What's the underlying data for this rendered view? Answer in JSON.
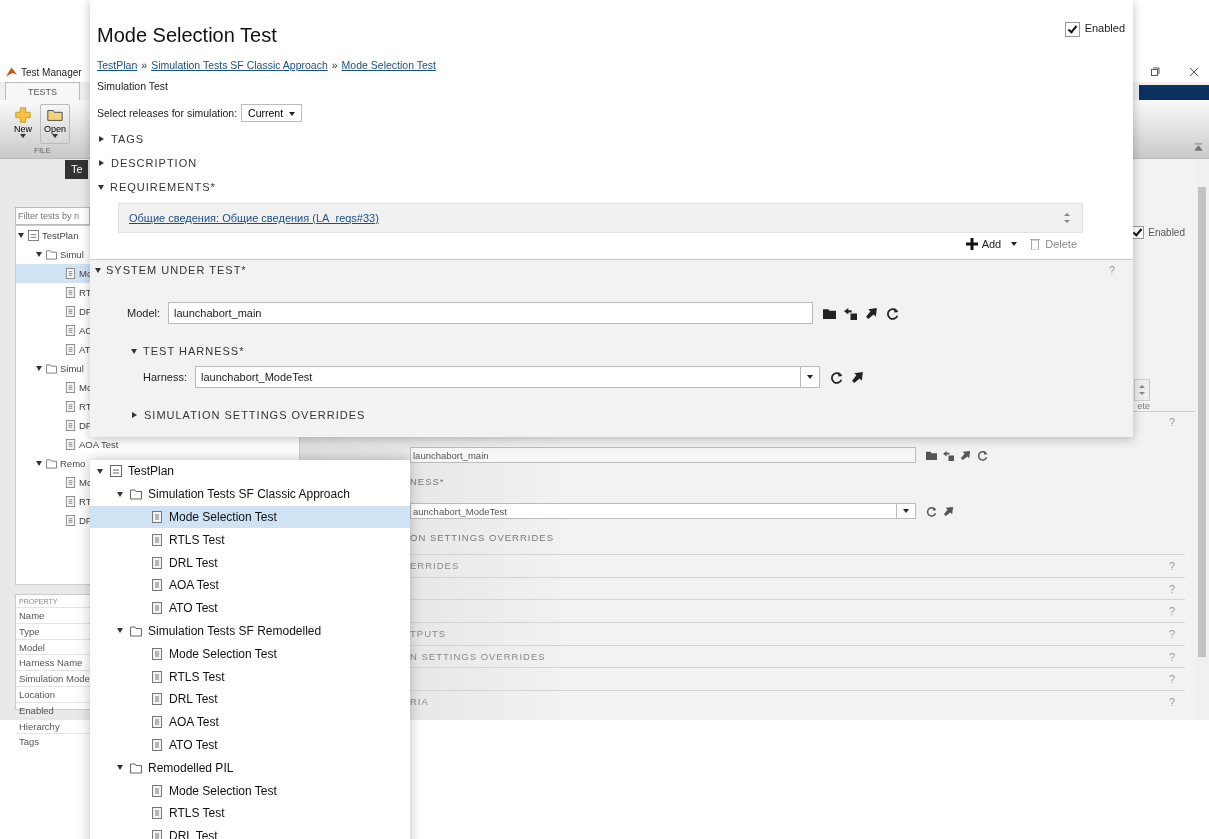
{
  "background_window": {
    "title": "Test Manager",
    "toolstrip_tab": "TESTS",
    "toolstrip_buttons": [
      {
        "label": "New",
        "kind": "new"
      },
      {
        "label": "Open",
        "kind": "open"
      }
    ],
    "toolstrip_group": "FILE",
    "browser_tab": "Te",
    "filter": {
      "placeholder": "Filter tests by n"
    },
    "tree": [
      {
        "label": "TestPlan",
        "kind": "plan",
        "expanded": true,
        "selected": false,
        "children": [
          {
            "label": "Simul",
            "kind": "folder",
            "expanded": true,
            "selected": false,
            "children": [
              {
                "label": "Mc",
                "kind": "test",
                "selected": true
              },
              {
                "label": "RT",
                "kind": "test",
                "selected": false
              },
              {
                "label": "DF",
                "kind": "test",
                "selected": false
              },
              {
                "label": "AC",
                "kind": "test",
                "selected": false
              },
              {
                "label": "AT",
                "kind": "test",
                "selected": false
              }
            ]
          },
          {
            "label": "Simul",
            "kind": "folder",
            "expanded": true,
            "selected": false,
            "children": [
              {
                "label": "Mc",
                "kind": "test",
                "selected": false
              },
              {
                "label": "RT",
                "kind": "test",
                "selected": false
              },
              {
                "label": "DF",
                "kind": "test",
                "selected": false
              },
              {
                "label": "AOA Test",
                "kind": "test",
                "selected": false
              }
            ]
          },
          {
            "label": "Remo",
            "kind": "folder",
            "expanded": true,
            "selected": false,
            "children": [
              {
                "label": "Mc",
                "kind": "test",
                "selected": false
              },
              {
                "label": "RT",
                "kind": "test",
                "selected": false
              },
              {
                "label": "DF",
                "kind": "test",
                "selected": false
              }
            ]
          }
        ]
      }
    ],
    "properties": {
      "header": "PROPERTY",
      "rows": [
        "Name",
        "Type",
        "Model",
        "Harness Name",
        "Simulation Mode",
        "Location",
        "Enabled",
        "Hierarchy",
        "Tags"
      ]
    },
    "enabled": {
      "label": "Enabled",
      "checked": true
    },
    "delete_fragment": "ete",
    "help": "?",
    "model_field": "launchabort_main",
    "harness_fragment": "NESS*",
    "harness_field": "aunchabort_ModeTest",
    "overrides_fragment": "ON SETTINGS OVERRIDES",
    "sections": [
      {
        "label": "ERRIDES",
        "help": "?"
      },
      {
        "help": "?"
      },
      {
        "help": "?"
      },
      {
        "label": "TPUTS",
        "help": "?"
      },
      {
        "label": "N SETTINGS OVERRIDES",
        "help": "?"
      },
      {
        "help": "?"
      },
      {
        "label": "RIA",
        "help": "?"
      }
    ]
  },
  "detail_panel": {
    "title": "Mode Selection Test",
    "enabled": {
      "label": "Enabled",
      "checked": true
    },
    "breadcrumb": [
      "TestPlan",
      "Simulation Tests SF Classic Approach",
      "Mode Selection Test"
    ],
    "breadcrumb_separator": "»",
    "test_type": "Simulation Test",
    "releases": {
      "label": "Select releases for simulation:",
      "value": "Current"
    },
    "tags": {
      "label": "TAGS",
      "expanded": false
    },
    "description": {
      "label": "DESCRIPTION",
      "expanded": false
    },
    "requirements": {
      "label": "REQUIREMENTS*",
      "expanded": true,
      "link": "Общие сведения: Общие сведения (LA_reqs#33)",
      "actions": [
        {
          "label": "Add",
          "kind": "add",
          "disabled": false
        },
        {
          "label": "Delete",
          "kind": "delete",
          "disabled": true
        }
      ]
    },
    "system_under_test": {
      "label": "SYSTEM UNDER TEST*",
      "expanded": true,
      "help": "?",
      "model": {
        "label": "Model:",
        "value": "launchabort_main"
      },
      "test_harness": {
        "label": "TEST HARNESS*",
        "expanded": true,
        "harness": {
          "label": "Harness:",
          "value": "launchabort_ModeTest"
        }
      },
      "simulation_settings_overrides": {
        "label": "SIMULATION SETTINGS OVERRIDES",
        "expanded": false
      }
    }
  },
  "tree_panel": {
    "tree": [
      {
        "label": "TestPlan",
        "kind": "plan",
        "expanded": true,
        "selected": false,
        "children": [
          {
            "label": "Simulation Tests SF Classic Approach",
            "kind": "folder",
            "expanded": true,
            "selected": false,
            "children": [
              {
                "label": "Mode Selection Test",
                "kind": "test",
                "selected": true
              },
              {
                "label": "RTLS Test",
                "kind": "test",
                "selected": false
              },
              {
                "label": "DRL Test",
                "kind": "test",
                "selected": false
              },
              {
                "label": "AOA Test",
                "kind": "test",
                "selected": false
              },
              {
                "label": "ATO Test",
                "kind": "test",
                "selected": false
              }
            ]
          },
          {
            "label": "Simulation Tests SF Remodelled",
            "kind": "folder",
            "expanded": true,
            "selected": false,
            "children": [
              {
                "label": "Mode Selection Test",
                "kind": "test",
                "selected": false
              },
              {
                "label": "RTLS Test",
                "kind": "test",
                "selected": false
              },
              {
                "label": "DRL Test",
                "kind": "test",
                "selected": false
              },
              {
                "label": "AOA Test",
                "kind": "test",
                "selected": false
              },
              {
                "label": "ATO Test",
                "kind": "test",
                "selected": false
              }
            ]
          },
          {
            "label": "Remodelled PIL",
            "kind": "folder",
            "expanded": true,
            "selected": false,
            "children": [
              {
                "label": "Mode Selection Test",
                "kind": "test",
                "selected": false
              },
              {
                "label": "RTLS Test",
                "kind": "test",
                "selected": false
              },
              {
                "label": "DRL Test",
                "kind": "test",
                "selected": false
              }
            ]
          }
        ]
      }
    ]
  }
}
